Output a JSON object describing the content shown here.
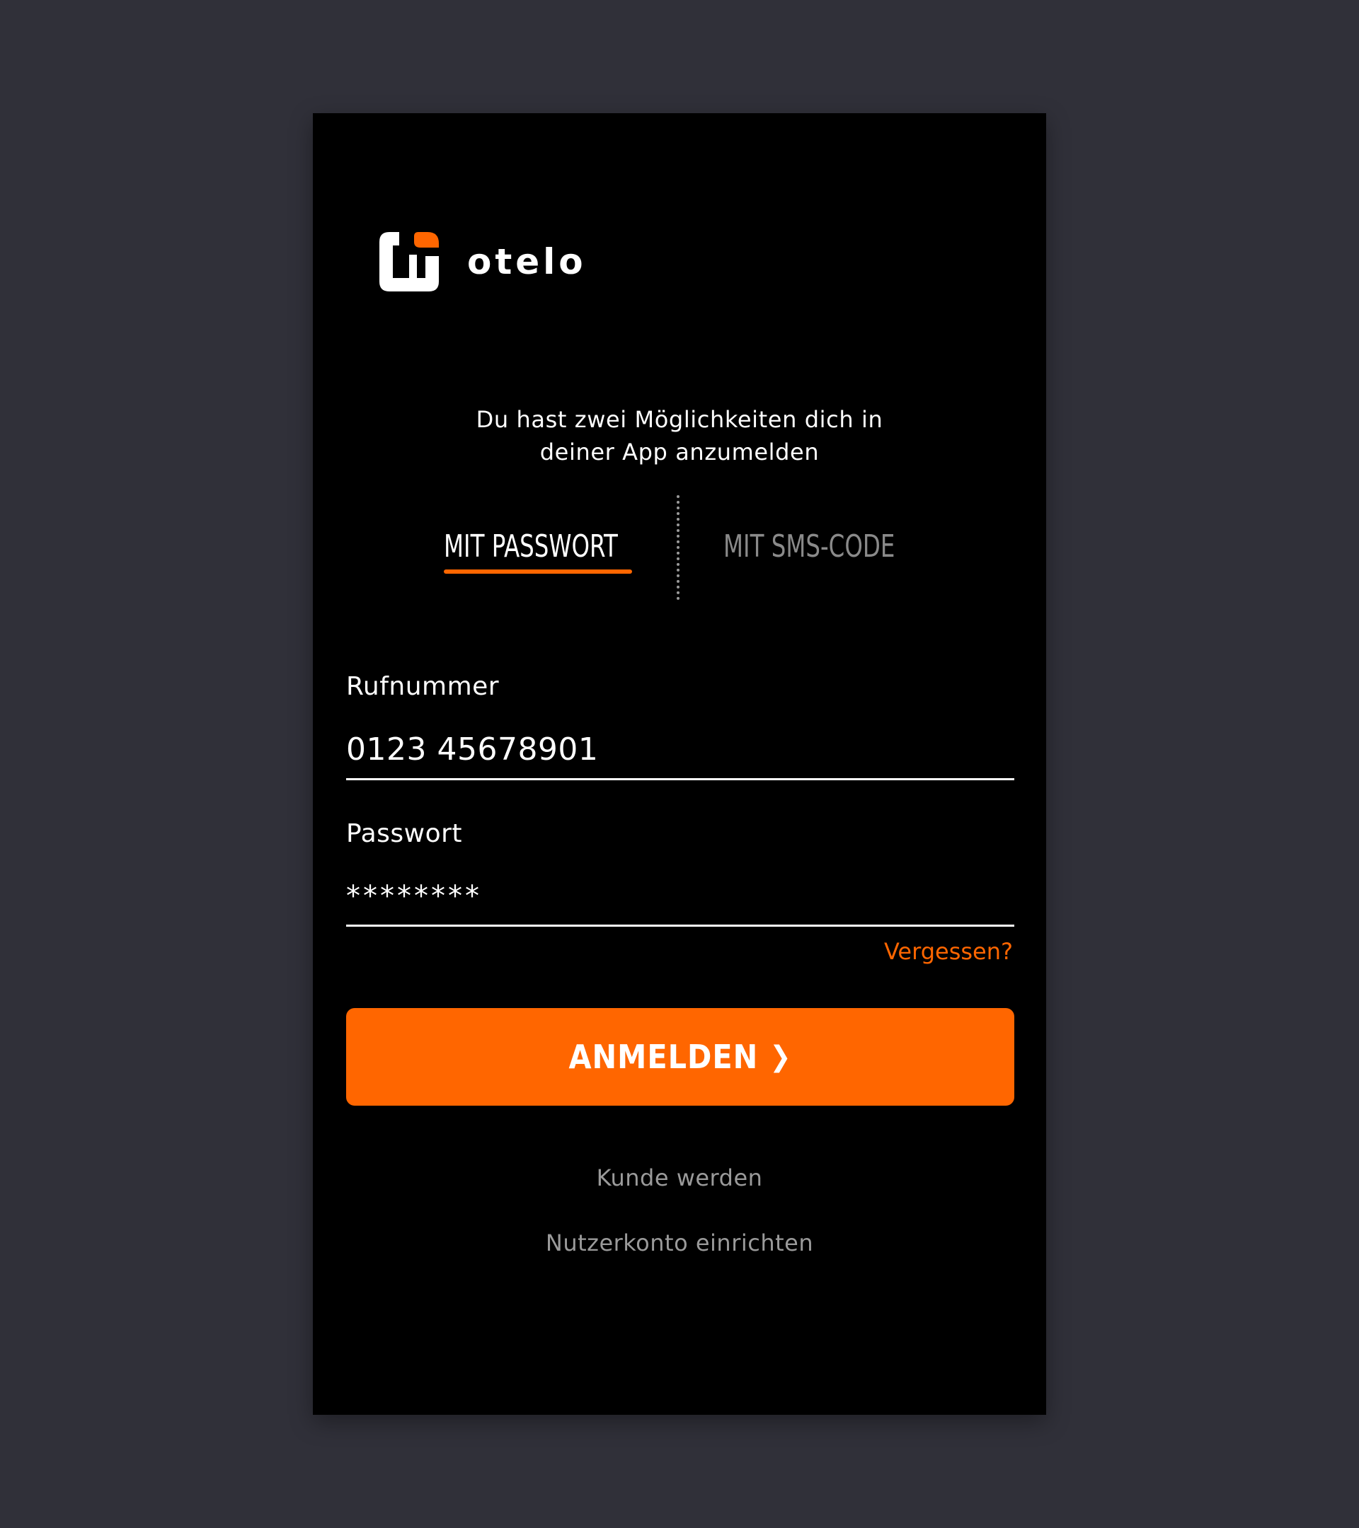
{
  "brand": {
    "wordmark": "otelo",
    "logo_icon": "otelo-logo-mark",
    "accent_color": "#ff6600"
  },
  "intro": {
    "line1": "Du hast zwei Möglichkeiten dich in",
    "line2": "deiner App anzumelden"
  },
  "tabs": [
    {
      "label": "MIT PASSWORT",
      "active": true
    },
    {
      "label": "MIT SMS-CODE",
      "active": false
    }
  ],
  "form": {
    "phone": {
      "label": "Rufnummer",
      "value": "0123 45678901"
    },
    "password": {
      "label": "Passwort",
      "value": "********"
    },
    "forgot_label": "Vergessen?"
  },
  "login_button": {
    "label": "ANMELDEN",
    "icon": "chevron-right-icon"
  },
  "links": {
    "become_customer": "Kunde werden",
    "create_account": "Nutzerkonto einrichten"
  }
}
